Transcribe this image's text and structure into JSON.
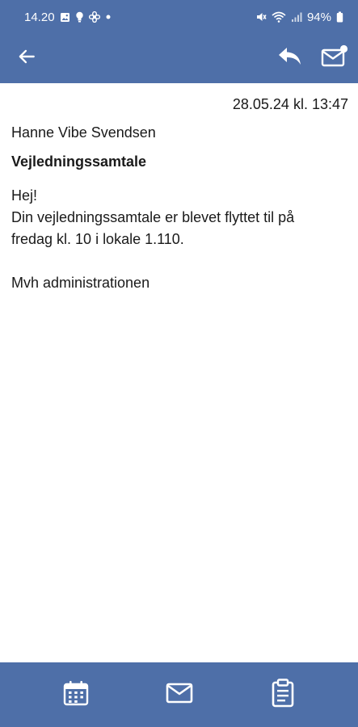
{
  "status_bar": {
    "time": "14.20",
    "notification_icons": [
      "image-icon",
      "bulb-icon",
      "fan-icon",
      "dot-icon"
    ],
    "system_icons": [
      "mute-icon",
      "wifi-icon",
      "signal-icon"
    ],
    "battery": "94%"
  },
  "app_bar": {
    "back_icon": "arrow-left-icon",
    "actions": [
      "reply-icon",
      "mail-unread-icon"
    ]
  },
  "message": {
    "date": "28.05.24 kl. 13:47",
    "sender": "Hanne Vibe Svendsen",
    "subject": "Vejledningssamtale",
    "body_lines": [
      "Hej!",
      "Din vejledningssamtale er blevet flyttet til på",
      "fredag kl. 10 i lokale 1.110.",
      "",
      "Mvh administrationen"
    ]
  },
  "bottom_nav": {
    "items": [
      "calendar-icon",
      "mail-icon",
      "clipboard-icon"
    ]
  },
  "colors": {
    "bar_background": "#4e6fa8",
    "text": "#1a1a1a",
    "on_bar": "#ffffff"
  }
}
